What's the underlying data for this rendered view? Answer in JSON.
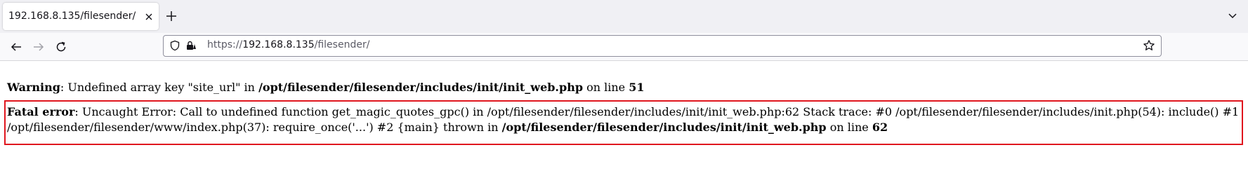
{
  "browser": {
    "tab_title": "192.168.8.135/filesender/",
    "url_prefix": "https://",
    "url_host": "192.168.8.135",
    "url_path": "/filesender/"
  },
  "page": {
    "warning": {
      "label": "Warning",
      "text_before_key": ": Undefined array key \"site_url\" in ",
      "file": "/opt/filesender/filesender/includes/init/init_web.php",
      "on_line": " on line ",
      "line": "51"
    },
    "fatal": {
      "label": "Fatal error",
      "message_line1": ": Uncaught Error: Call to undefined function get_magic_quotes_gpc() in /opt/filesender/filesender/includes/init/init_web.php:62 Stack trace: #0 /opt/filesender/filesender/includes/init.php(54): include() #1",
      "message_line2": "/opt/filesender/filesender/www/index.php(37): require_once('...') #2 {main} thrown in ",
      "file": "/opt/filesender/filesender/includes/init/init_web.php",
      "on_line": " on line ",
      "line": "62"
    }
  }
}
